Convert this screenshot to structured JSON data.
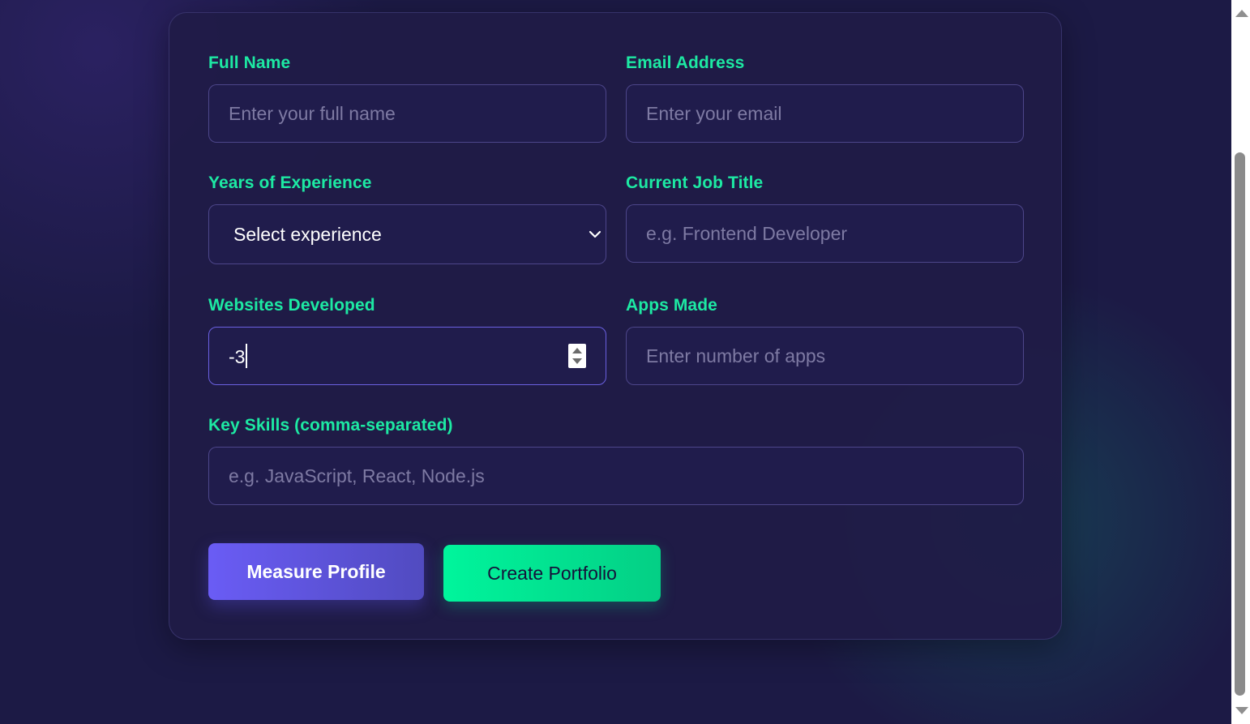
{
  "form": {
    "full_name": {
      "label": "Full Name",
      "placeholder": "Enter your full name",
      "value": ""
    },
    "email": {
      "label": "Email Address",
      "placeholder": "Enter your email",
      "value": ""
    },
    "experience": {
      "label": "Years of Experience",
      "selected": "Select experience"
    },
    "job_title": {
      "label": "Current Job Title",
      "placeholder": "e.g. Frontend Developer",
      "value": ""
    },
    "websites": {
      "label": "Websites Developed",
      "value": "-3"
    },
    "apps": {
      "label": "Apps Made",
      "placeholder": "Enter number of apps",
      "value": ""
    },
    "skills": {
      "label": "Key Skills (comma-separated)",
      "placeholder": "e.g. JavaScript, React, Node.js",
      "value": ""
    }
  },
  "buttons": {
    "measure_label": "Measure Profile",
    "create_label": "Create Portfolio"
  },
  "colors": {
    "label_accent": "#1de9a3",
    "measure_button": "#6a5cf5",
    "create_button": "#00f59c",
    "background": "#1c1a45"
  },
  "icons": {
    "select": "chevron-down-icon",
    "spinner_up": "spinner-up-icon",
    "spinner_down": "spinner-down-icon"
  }
}
